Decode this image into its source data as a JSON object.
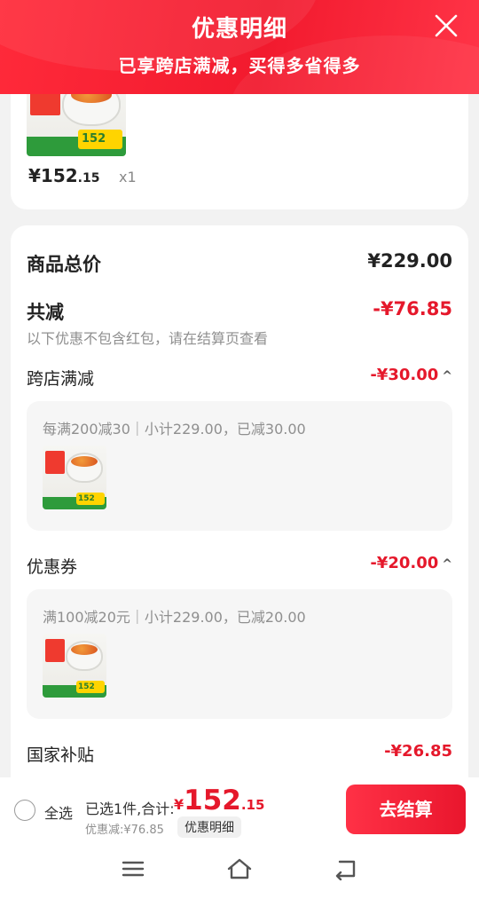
{
  "header": {
    "title": "优惠明细",
    "subtitle": "已享跨店满减，买得多省得多"
  },
  "top_item": {
    "price_yen": "¥",
    "price_int": "152",
    "price_dec": ".15",
    "quantity": "x1",
    "thumb_tag": "152"
  },
  "summary": {
    "total_label": "商品总价",
    "total_value": "¥229.00",
    "discount_label": "共减",
    "discount_value": "-¥76.85",
    "note": "以下优惠不包含红包，请在结算页查看"
  },
  "cross_store": {
    "label": "跨店满减",
    "value": "-¥30.00",
    "detail": "每满200减30｜小计229.00，已减30.00",
    "thumb_tag": "152"
  },
  "coupon": {
    "label": "优惠券",
    "value": "-¥20.00",
    "detail": "满100减20元｜小计229.00，已减20.00",
    "thumb_tag": "152"
  },
  "subsidy": {
    "label": "国家补贴",
    "value": "-¥26.85"
  },
  "bottom_bar": {
    "select_all": "全选",
    "selected_summary": "已选1件,合计:",
    "total_yen": "¥",
    "total_int": "152",
    "total_dec": ".15",
    "saved": "优惠减:¥76.85",
    "detail_button": "优惠明细",
    "checkout_button": "去结算"
  },
  "colors": {
    "accent_red": "#e5182b",
    "header_red": "#f21a2e"
  },
  "icons": {
    "close": "close-icon",
    "chevron": "chevron-up-icon",
    "menu": "menu-icon",
    "home": "home-icon",
    "back": "back-icon"
  }
}
